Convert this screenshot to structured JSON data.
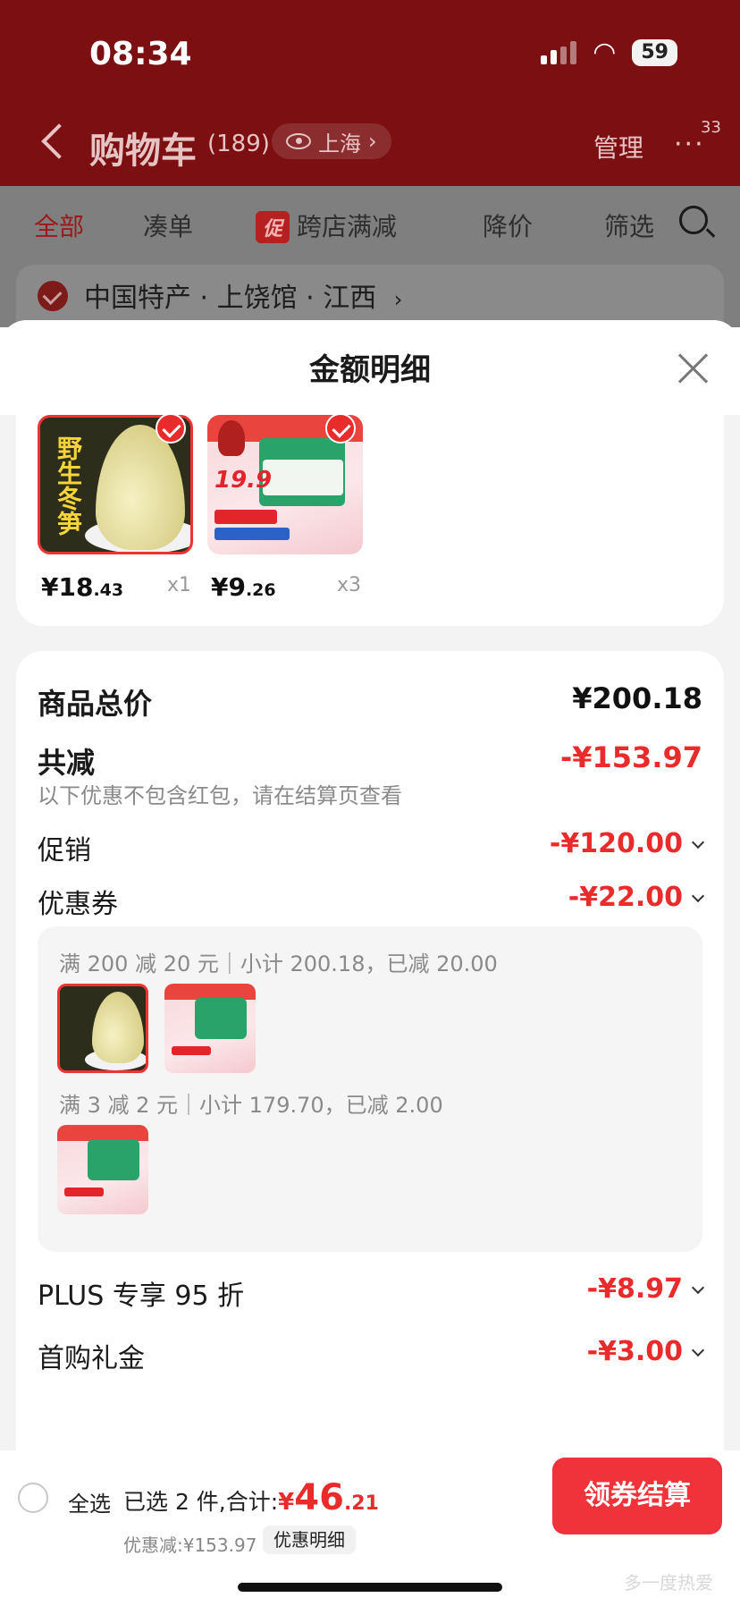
{
  "status_bar": {
    "time": "08:34",
    "battery": "59"
  },
  "nav": {
    "title": "购物车",
    "count": "(189)",
    "location": "上海",
    "manage": "管理",
    "more": "···",
    "badge": "33"
  },
  "tabs": [
    {
      "label": "全部",
      "active": true
    },
    {
      "label": "凑单"
    },
    {
      "label": "跨店满减",
      "tag": "促"
    },
    {
      "label": "降价"
    },
    {
      "label": "筛选"
    }
  ],
  "store": {
    "name": "中国特产 · 上饶馆 · 江西",
    "chevron": "›"
  },
  "sheet": {
    "title": "金额明细",
    "products": [
      {
        "name": "野生冬笋",
        "price_symbol": "¥",
        "price_int": "18",
        "price_dec": ".43",
        "qty": "x1",
        "icon": "bamboo-shoot"
      },
      {
        "name": "十月稻田白糯玉米段",
        "price_symbol": "¥",
        "price_int": "9",
        "price_dec": ".26",
        "qty": "x3",
        "icon": "corn-package",
        "img_price": "19.9"
      }
    ],
    "total_label": "商品总价",
    "total_value": "¥200.18",
    "discount_label": "共减",
    "discount_value": "-¥153.97",
    "note": "以下优惠不包含红包，请在结算页查看",
    "promo_label": "促销",
    "promo_value": "-¥120.00",
    "coupon_label": "优惠券",
    "coupon_value": "-¥22.00",
    "coupon_items": [
      {
        "text": "满 200 减 20 元｜小计 200.18，已减 20.00"
      },
      {
        "text": "满 3 减 2 元｜小计 179.70，已减 2.00"
      }
    ],
    "plus_label": "PLUS 专享 95 折",
    "plus_value": "-¥8.97",
    "first_label": "首购礼金",
    "first_value": "-¥3.00"
  },
  "bottom": {
    "select_all": "全选",
    "selected_text": "已选 2 件,合计:",
    "total_symbol": "¥",
    "total_int": "46",
    "total_dec": ".21",
    "saved_text": "优惠减:¥153.97",
    "detail_chip": "优惠明细",
    "checkout": "领券结算",
    "watermark": "多一度热爱"
  },
  "colors": {
    "accent": "#e92b2b",
    "header": "#7b0f12",
    "checkout": "#f0323a"
  }
}
